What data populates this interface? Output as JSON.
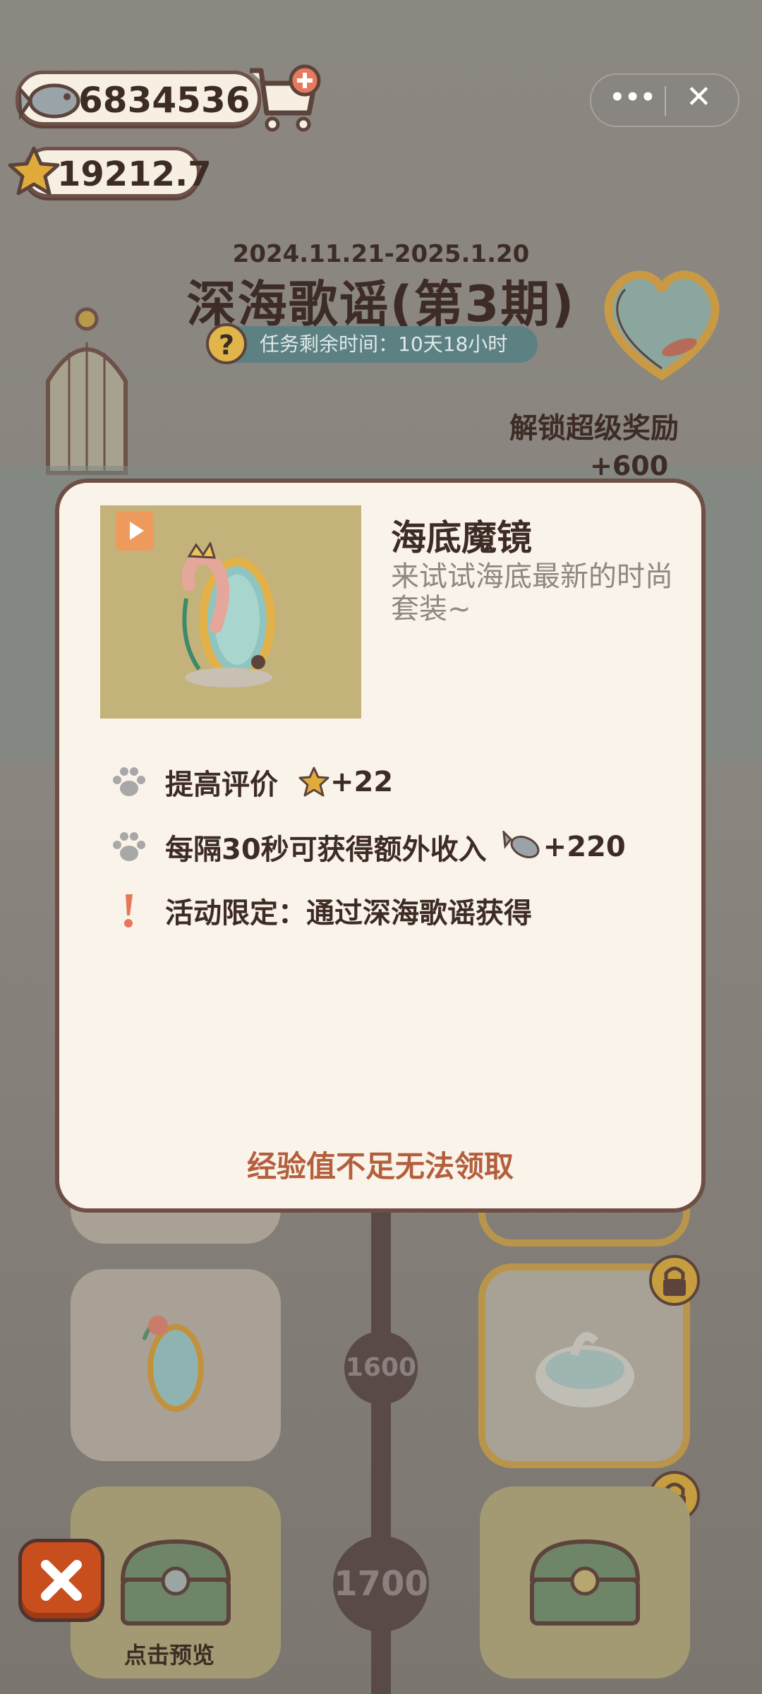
{
  "currency": {
    "fish_amount": "6834536",
    "star_amount": "19212.7"
  },
  "window_controls": {
    "more_label": "•••",
    "close_label": "✕"
  },
  "event": {
    "date_range": "2024.11.21-2025.1.20",
    "title": "深海歌谣(第3期)",
    "remaining_time": "任务剩余时间：10天18小时",
    "unlock_label": "解锁超级奖励",
    "unlock_amount": "+600"
  },
  "modal": {
    "item_name": "海底魔镜",
    "item_description": "来试试海底最新的时尚套装~",
    "stats": [
      {
        "label": "提高评价",
        "value": "+22",
        "icon": "star-icon"
      },
      {
        "label": "每隔30秒可获得额外收入",
        "value": "+220",
        "icon": "fish-icon"
      }
    ],
    "limited_note": "活动限定：通过深海歌谣获得",
    "claim_status": "经验值不足无法领取"
  },
  "track": {
    "nodes": [
      "1600",
      "1700"
    ],
    "preview_label": "点击预览"
  },
  "colors": {
    "accent": "#b35f3e",
    "modal_border": "#6f4f45",
    "text_dark": "#3d2c25",
    "timer_bg": "#5d8083",
    "close_button": "#c94e1d"
  }
}
